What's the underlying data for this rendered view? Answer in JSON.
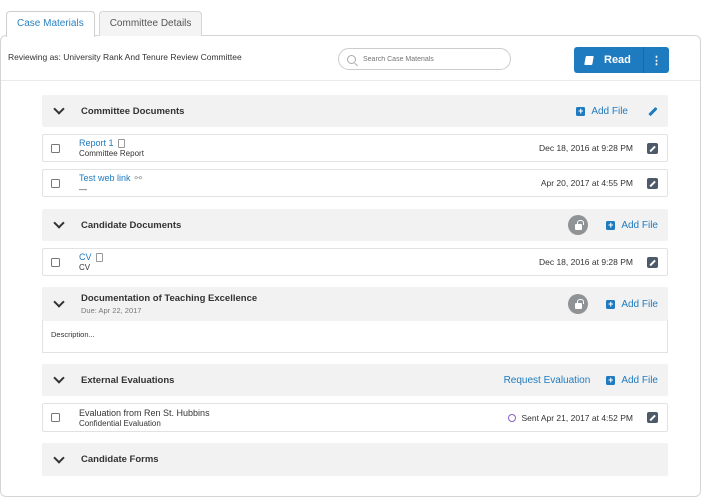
{
  "tabs": [
    "Case Materials",
    "Committee Details"
  ],
  "reviewing_label": "Reviewing as: University Rank And Tenure Review Committee",
  "search": {
    "placeholder": "Search Case Materials"
  },
  "read_button": {
    "label": "Read",
    "more": "⋮"
  },
  "sections": {
    "committee_docs": {
      "title": "Committee Documents",
      "add": "Add File"
    },
    "candidate_docs": {
      "title": "Candidate Documents",
      "add": "Add File"
    },
    "teaching": {
      "title": "Documentation of Teaching Excellence",
      "due": "Due: Apr 22, 2017",
      "add": "Add File",
      "description": "Description..."
    },
    "external": {
      "title": "External Evaluations",
      "request": "Request Evaluation",
      "add": "Add File"
    },
    "forms": {
      "title": "Candidate Forms"
    }
  },
  "rows": {
    "report1": {
      "title": "Report 1",
      "sub": "Committee Report",
      "date": "Dec 18, 2016 at 9:28 PM"
    },
    "weblink": {
      "title": "Test web link",
      "sub": "—",
      "date": "Apr 20, 2017 at 4:55 PM"
    },
    "cv": {
      "title": "CV",
      "sub": "CV",
      "date": "Dec 18, 2016 at 9:28 PM"
    },
    "evaluation": {
      "title": "Evaluation from Ren St. Hubbins",
      "sub": "Confidential Evaluation",
      "date": "Sent Apr 21, 2017 at 4:52 PM"
    }
  }
}
